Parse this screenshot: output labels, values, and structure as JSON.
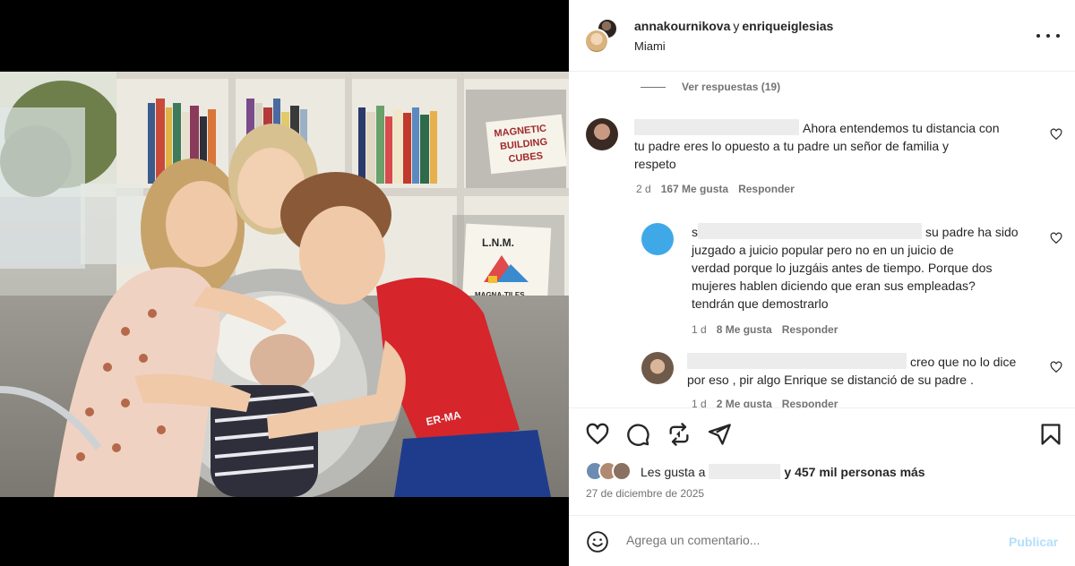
{
  "post": {
    "header": {
      "author_primary": "annakournikova",
      "joiner": "y",
      "author_secondary": "enriqueiglesias",
      "location": "Miami",
      "more_icon": "more-horizontal-icon"
    },
    "media": {
      "description_icon": "user-tag-icon",
      "shelf_sign_1_line1": "MAGNETIC",
      "shelf_sign_1_line2": "BUILDING",
      "shelf_sign_1_line3": "CUBES",
      "shelf_sign_2_line1": "L.N.M.",
      "shelf_sign_2_line2": "MAGNA-TILES"
    },
    "comments": {
      "view_replies": "Ver respuestas (19)",
      "items": [
        {
          "text": "Ahora entendemos tu distancia con tu padre eres lo opuesto a tu padre un señor de familia y respeto",
          "line1": "Ahora entendemos tu distancia con",
          "line2": "tu padre eres lo opuesto a tu padre un señor de familia y",
          "line3": "respeto",
          "time": "2 d",
          "likes": "167 Me gusta",
          "reply": "Responder"
        },
        {
          "prefix": "s",
          "line1": "su padre ha sido",
          "line2": "juzgado a juicio popular pero no en un juicio de",
          "line3": "verdad porque lo juzgáis antes de tiempo. Porque dos",
          "line4": "mujeres hablen diciendo que eran sus empleadas?",
          "line5": "tendrán que demostrarlo",
          "time": "1 d",
          "likes": "8 Me gusta",
          "reply": "Responder"
        },
        {
          "line1": "creo que no lo dice",
          "line2": "por eso , pir algo Enrique se distanció de su padre .",
          "time": "1 d",
          "likes": "2 Me gusta",
          "reply": "Responder"
        }
      ]
    },
    "actions": {
      "like_icon": "heart-icon",
      "comment_icon": "comment-icon",
      "repost_icon": "repost-icon",
      "share_icon": "send-icon",
      "save_icon": "bookmark-icon",
      "likes_prefix": "Les gusta a",
      "likes_count": "y 457 mil personas más",
      "date": "27 de diciembre de 2025"
    },
    "add_comment": {
      "emoji_icon": "emoji-icon",
      "placeholder": "Agrega un comentario...",
      "publish": "Publicar"
    }
  },
  "colors": {
    "secondary_text": "#737373",
    "publish_disabled": "#b2dffc",
    "border": "#efefef"
  }
}
